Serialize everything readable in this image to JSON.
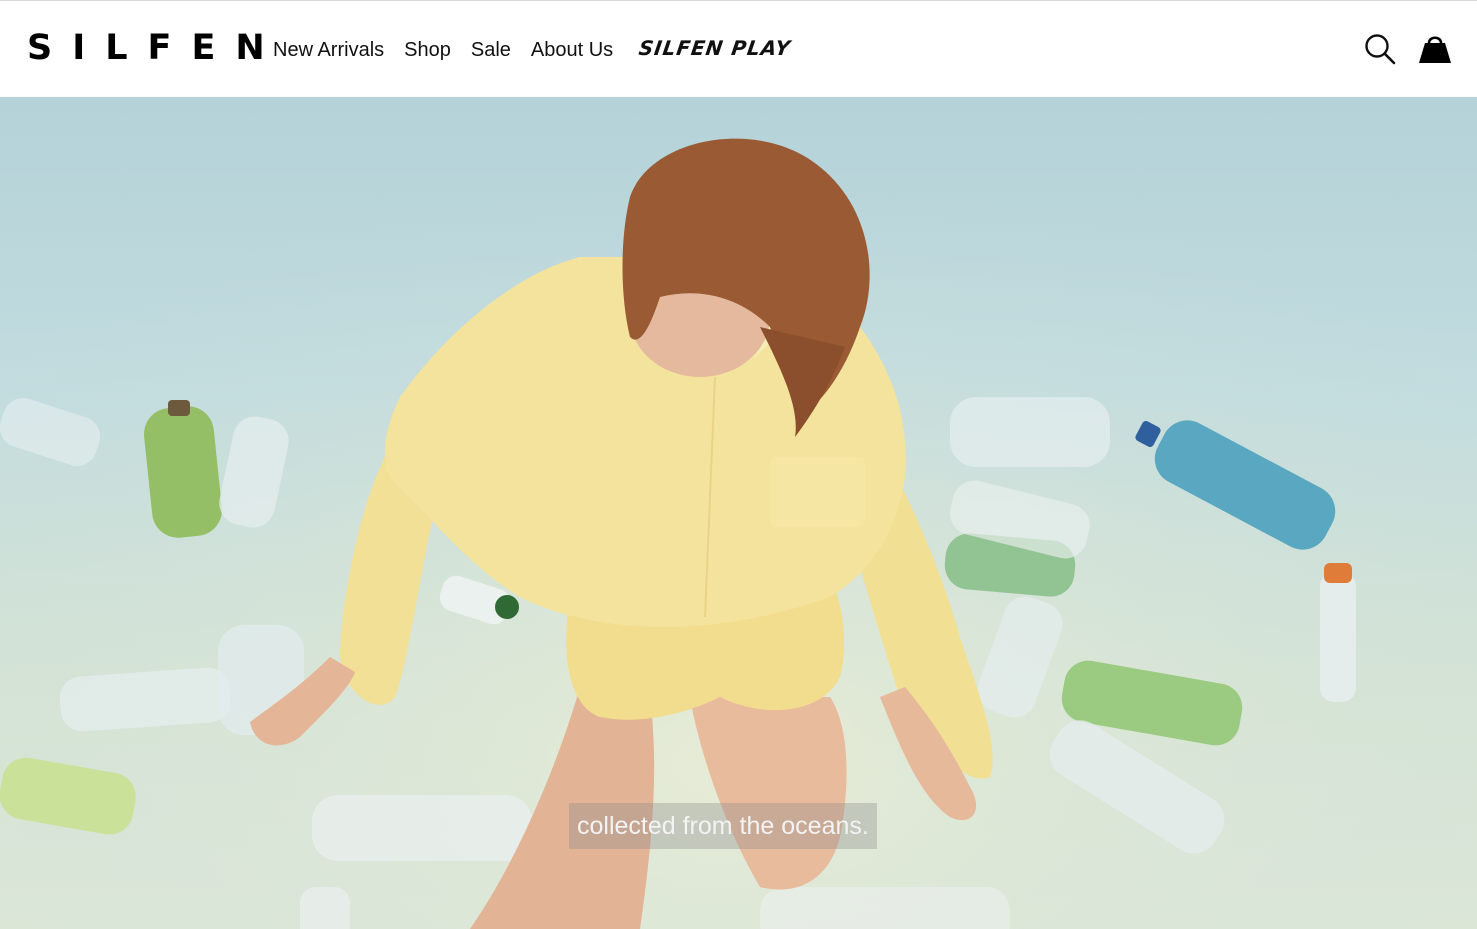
{
  "header": {
    "logo": "SILFEN",
    "nav": [
      "New Arrivals",
      "Shop",
      "Sale",
      "About Us"
    ],
    "play_logo": "SILFEN PLAY",
    "icons": {
      "search": "search-icon",
      "cart": "shopping-bag-icon"
    }
  },
  "hero": {
    "caption": "collected from the oceans.",
    "colors": {
      "background": "#c2dcdf",
      "shirt": "#f0e09a",
      "hair": "#9a5a34"
    }
  }
}
